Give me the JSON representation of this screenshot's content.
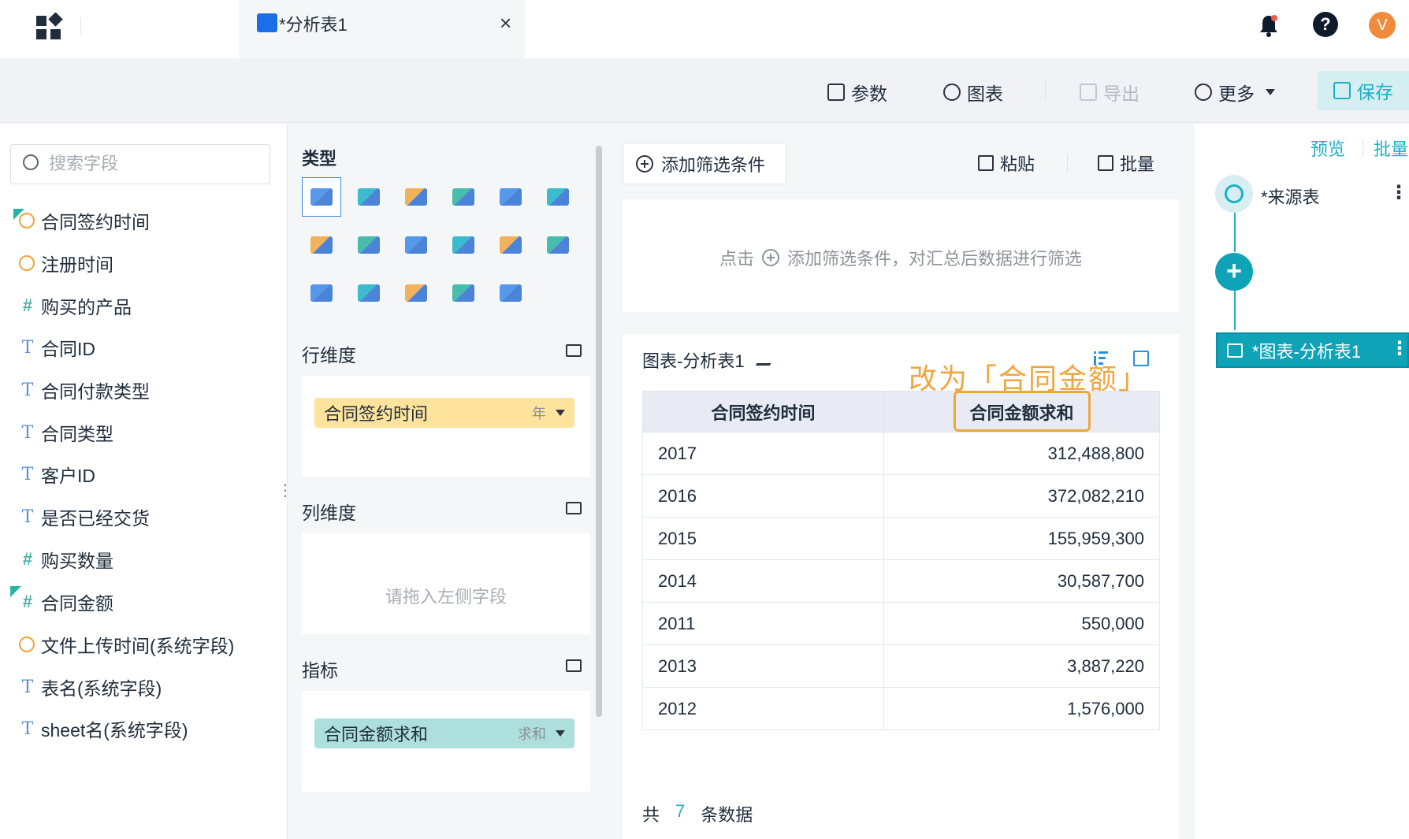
{
  "tab": {
    "title": "*分析表1",
    "close": "×"
  },
  "header": {
    "help": "?",
    "avatar": "V"
  },
  "toolbar": {
    "param": "参数",
    "chart": "图表",
    "export": "导出",
    "more": "更多",
    "save": "保存"
  },
  "fields": {
    "search_placeholder": "搜索字段",
    "items": [
      {
        "label": "合同签约时间",
        "type": "time",
        "flagged": true
      },
      {
        "label": "注册时间",
        "type": "time"
      },
      {
        "label": "购买的产品",
        "type": "number"
      },
      {
        "label": "合同ID",
        "type": "text"
      },
      {
        "label": "合同付款类型",
        "type": "text"
      },
      {
        "label": "合同类型",
        "type": "text"
      },
      {
        "label": "客户ID",
        "type": "text"
      },
      {
        "label": "是否已经交货",
        "type": "text"
      },
      {
        "label": "购买数量",
        "type": "number"
      },
      {
        "label": "合同金额",
        "type": "number",
        "flagged": true
      },
      {
        "label": "文件上传时间(系统字段)",
        "type": "time"
      },
      {
        "label": "表名(系统字段)",
        "type": "text"
      },
      {
        "label": "sheet名(系统字段)",
        "type": "text"
      }
    ]
  },
  "config": {
    "type_title": "类型",
    "row_title": "行维度",
    "row_pill": {
      "label": "合同签约时间",
      "agg": "年"
    },
    "col_title": "列维度",
    "col_empty": "请拖入左侧字段",
    "metric_title": "指标",
    "metric_pill": {
      "label": "合同金额求和",
      "agg": "求和"
    },
    "chart_types": [
      "table-icon",
      "detail-table-icon",
      "bar-chart-icon",
      "horizontal-bar-icon",
      "line-chart-icon",
      "pie-chart-icon",
      "area-chart-icon",
      "map-icon",
      "gauge-icon",
      "stacked-bar-icon",
      "scatter-icon",
      "dashboard-icon",
      "radar-icon",
      "funnel-icon",
      "number-card-icon",
      "word-cloud-icon",
      "heatmap-icon"
    ]
  },
  "filter": {
    "add": "添加筛选条件",
    "paste": "粘贴",
    "batch": "批量",
    "hint_prefix": "点击",
    "hint_suffix": "添加筛选条件，对汇总后数据进行筛选"
  },
  "chart": {
    "title": "图表-分析表1",
    "annotation": "改为「合同金额」",
    "columns": [
      "合同签约时间",
      "合同金额求和"
    ],
    "rows": [
      [
        "2017",
        "312,488,800"
      ],
      [
        "2016",
        "372,082,210"
      ],
      [
        "2015",
        "155,959,300"
      ],
      [
        "2014",
        "30,587,700"
      ],
      [
        "2011",
        "550,000"
      ],
      [
        "2013",
        "3,887,220"
      ],
      [
        "2012",
        "1,576,000"
      ]
    ],
    "count_prefix": "共",
    "count": "7",
    "count_suffix": "条数据"
  },
  "flow": {
    "preview": "预览",
    "batch": "批量",
    "source": "*来源表",
    "node": "*图表-分析表1",
    "menu": "⋮"
  },
  "colors": {
    "accent": "#1bb1c6",
    "annotation": "#f0a640",
    "row_pill": "#fde39c",
    "metric_pill": "#ade0dc"
  }
}
